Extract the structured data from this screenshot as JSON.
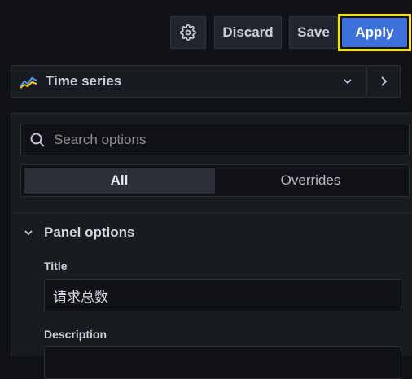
{
  "toolbar": {
    "settings_icon": "gear-icon",
    "discard_label": "Discard",
    "save_label": "Save",
    "apply_label": "Apply"
  },
  "visualization": {
    "name": "Time series",
    "icon": "time-series-icon"
  },
  "options": {
    "search_placeholder": "Search options",
    "tabs": [
      {
        "label": "All",
        "active": true
      },
      {
        "label": "Overrides",
        "active": false
      }
    ],
    "section": {
      "title": "Panel options",
      "fields": {
        "title_label": "Title",
        "title_value": "请求总数",
        "description_label": "Description",
        "description_value": ""
      }
    }
  },
  "colors": {
    "accent": "#3d71d9",
    "highlight": "#f5e400",
    "background": "#111217"
  }
}
